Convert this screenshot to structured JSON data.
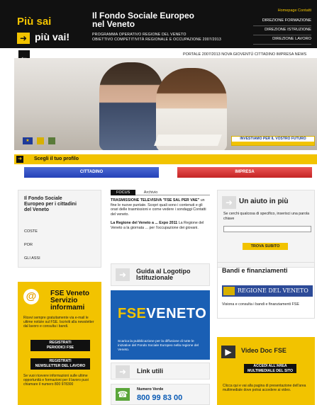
{
  "header": {
    "logo_line1": "Più sai",
    "logo_line2": "più vai!",
    "title_line1": "Il Fondo Sociale Europeo",
    "title_line2": "nel Veneto",
    "subtitle_line1": "PROGRAMMA OPERATIVO REGIONE DEL VENETO",
    "subtitle_line2": "OBIETTIVO COMPETITIVITÀ REGIONALE E OCCUPAZIONE 2007/2013",
    "top_links": "Homepage  Contatti",
    "directions": [
      "DIREZIONE FORMAZIONE",
      "DIREZIONE ISTRUZIONE",
      "DIREZIONE LAVORO"
    ]
  },
  "subnav": "PORTALE 2007/2013   NOVA GIOVENTÙ   CITTADINO   IMPRESA   NEWS",
  "hero": {
    "invest_label": "INVESTIAMO PER IL VOSTRO FUTURO",
    "eu_flag": "★"
  },
  "profile": {
    "label": "Scegli il tuo profilo",
    "cittadino": "CITTADINO",
    "impresa": "IMPRESA"
  },
  "left_panel": {
    "title": "Il Fondo Sociale Europeo per i cittadini del Veneto",
    "items": [
      "COSTE",
      "POR",
      "GLI ASSI"
    ]
  },
  "focus": {
    "tab_active": "FOCUS",
    "tab_other": "Archivio",
    "news": [
      {
        "title": "TRASMISSIONE TELEVISIVA \"FSE SAL PER VAE\"",
        "body": "un fine le nuove puntate. Scopri quali sono i contenuti e gli orari delle trasmissioni e come vedere i sondaggi Contatti del veneto."
      },
      {
        "title": "La Regione del Veneto a ... Expo 2011",
        "body": "La Regione del Veneto a la giornata ... per l'occupazione dei giovani."
      }
    ]
  },
  "aiuto": {
    "title": "Un aiuto in più",
    "desc": "Se cerchi qualcosa di specifico, inserisci una parola chiave",
    "button": "TROVA SUBITO"
  },
  "guida": {
    "title_line1": "Guida al Logotipo",
    "title_line2": "Istituzionale"
  },
  "bandi": {
    "title": "Bandi e finanziamenti",
    "regione": "REGIONE DEL VENETO",
    "desc": "Visiona e consulta i bandi e finanziamenti FSE"
  },
  "fse_info": {
    "title_line1": "FSE Veneto",
    "title_line2": "Servizio",
    "title_line3": "informami",
    "desc": "Ricevi sempre gratuitamente via e-mail le ultime notizie sul FSE. Iscriviti alla newsletter dal lavoro e consulta i bandi.",
    "btn1_line1": "REGISTRATI",
    "btn1_line2": "PERIODICI FSE",
    "btn2_line1": "REGISTRATI",
    "btn2_line2": "NEWSLETTER DEL LAVORO",
    "foot": "Se vuoi ricevere informazioni sulle ultime opportunità e formazioni per il lavoro puoi chiamare il numero 800 978300"
  },
  "fse_logo": {
    "word1": "FSE",
    "word2": "VENETO",
    "desc": "Scarica la pubblicazione per la diffusione di tutte le iniziative del Fondo Sociale Europeo nella regione del Veneto."
  },
  "video": {
    "title": "Video Doc FSE",
    "button_line1": "ACCEDI ALL'AREA",
    "button_line2": "MULTIMEDIALE DEL SITO",
    "desc": "Clicca qui e vai alla pagina di presentazione dell'area multimediale dove potrai accedere ai video."
  },
  "link_utili": {
    "title": "Link utili"
  },
  "numero_verde": {
    "label": "Numero Verde",
    "number": "800 99 83 00"
  }
}
